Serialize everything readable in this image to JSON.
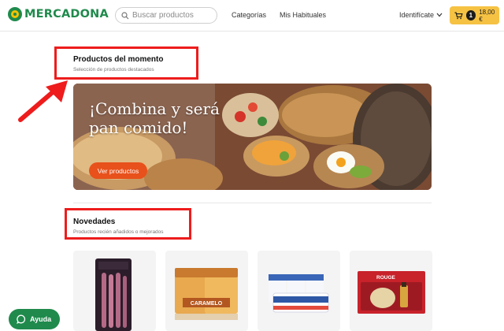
{
  "header": {
    "brand": "MERCADONA",
    "search_placeholder": "Buscar productos",
    "nav": [
      "Categorías",
      "Mis Habituales"
    ],
    "account_label": "Identifícate",
    "cart_count": "1",
    "cart_total": "18,00 €"
  },
  "featured": {
    "title": "Productos del momento",
    "subtitle": "Selección de productos destacados",
    "banner_headline": "¡Combina y será pan comido!",
    "banner_button": "Ver productos"
  },
  "novedades": {
    "title": "Novedades",
    "subtitle": "Productos recién añadidos o mejorados",
    "products": [
      {
        "image": "sausage-pack"
      },
      {
        "image": "caramel-flan-pack",
        "package_text": "CARAMELO"
      },
      {
        "image": "yogurt-pack"
      },
      {
        "image": "rouge-gift-box",
        "package_text": "ROUGE"
      }
    ]
  },
  "help_button": "Ayuda",
  "colors": {
    "brand_green": "#1f8a4c",
    "cart_yellow": "#f6c243",
    "banner_button": "#e8511b",
    "annotation_red": "#ee1c1c"
  }
}
